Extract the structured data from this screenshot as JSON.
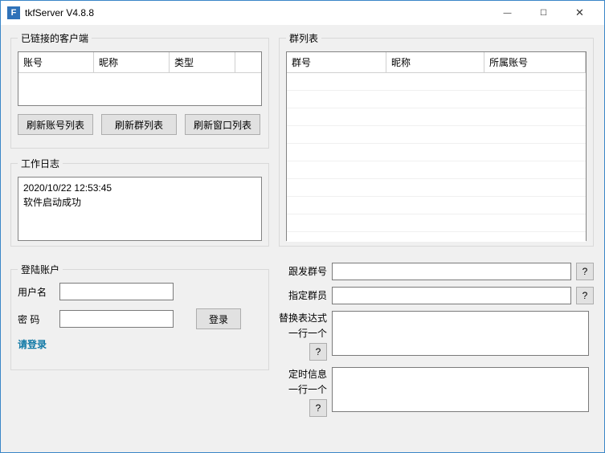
{
  "window": {
    "title": "tkfServer  V4.8.8",
    "icon_letter": "F"
  },
  "clients_box": {
    "legend": "已链接的客户端",
    "columns": {
      "c1": "账号",
      "c2": "昵称",
      "c3": "类型"
    }
  },
  "buttons": {
    "refresh_accounts": "刷新账号列表",
    "refresh_groups": "刷新群列表",
    "refresh_windows": "刷新窗口列表",
    "login": "登录",
    "help": "?"
  },
  "log_box": {
    "legend": "工作日志",
    "content": "2020/10/22 12:53:45\n软件启动成功"
  },
  "login_box": {
    "legend": "登陆账户",
    "user_label": "用户名",
    "pass_label": "密  码",
    "status": "请登录"
  },
  "groups_box": {
    "legend": "群列表",
    "columns": {
      "c1": "群号",
      "c2": "昵称",
      "c3": "所属账号"
    }
  },
  "right_form": {
    "follow_group": "跟发群号",
    "assign_member": "指定群员",
    "replace_expr": "替换表达式",
    "one_per_line": "一行一个",
    "timed_info": "定时信息"
  }
}
